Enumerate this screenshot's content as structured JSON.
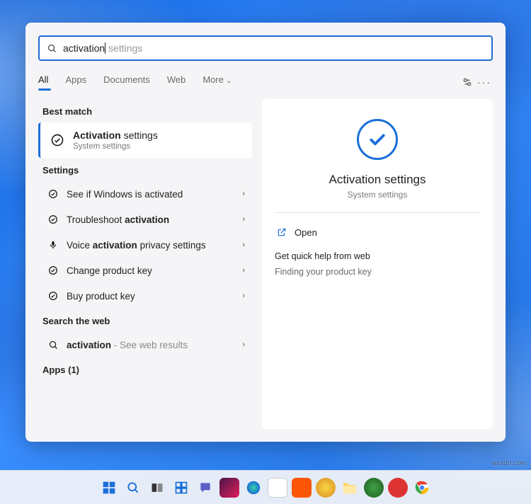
{
  "search": {
    "typed": "activation",
    "ghost": " settings"
  },
  "tabs": {
    "all": "All",
    "apps": "Apps",
    "documents": "Documents",
    "web": "Web",
    "more": "More"
  },
  "sections": {
    "best_match": "Best match",
    "settings": "Settings",
    "search_web": "Search the web",
    "apps_count": "Apps (1)"
  },
  "best_match": {
    "title_strong": "Activation",
    "title_rest": " settings",
    "subtitle": "System settings"
  },
  "settings_rows": [
    {
      "pre": "See if Windows is ",
      "strong": "",
      "post": "activated"
    },
    {
      "pre": "Troubleshoot ",
      "strong": "activation",
      "post": ""
    },
    {
      "pre": "Voice ",
      "strong": "activation",
      "post": " privacy settings",
      "mic": true
    },
    {
      "pre": "Change product key",
      "strong": "",
      "post": ""
    },
    {
      "pre": "Buy product key",
      "strong": "",
      "post": ""
    }
  ],
  "web_row": {
    "strong": "activation",
    "hint": " - See web results"
  },
  "preview": {
    "title": "Activation settings",
    "subtitle": "System settings",
    "open": "Open",
    "help_header": "Get quick help from web",
    "help_link": "Finding your product key"
  },
  "watermark": "wsxdn.com"
}
